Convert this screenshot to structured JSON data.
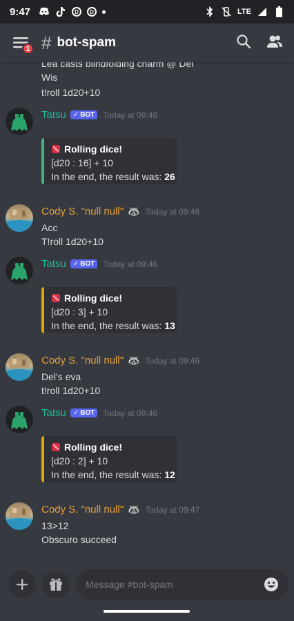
{
  "status_bar": {
    "time": "9:47",
    "lte": "LTE"
  },
  "header": {
    "hash": "#",
    "channel": "bot-spam",
    "badge_count": "1"
  },
  "messages": {
    "m0": {
      "line1": "Lea casts blindfolding charm @ Del",
      "line2": "Wis",
      "line3": "t!roll 1d20+10"
    },
    "m1": {
      "user": "Tatsu",
      "bot": "BOT",
      "time": "Today at 09:46",
      "embed": {
        "title": "Rolling dice!",
        "roll": "[d20 : 16] + 10",
        "result_prefix": "In the end, the result was: ",
        "result": "26",
        "accent": "#43b581"
      }
    },
    "m2": {
      "user": "Cody S. \"null null\"",
      "time": "Today at 09:46",
      "line1": "Acc",
      "line2": "T!roll 1d20+10"
    },
    "m3": {
      "user": "Tatsu",
      "bot": "BOT",
      "time": "Today at 09:46",
      "embed": {
        "title": "Rolling dice!",
        "roll": "[d20 : 3] + 10",
        "result_prefix": "In the end, the result was: ",
        "result": "13",
        "accent": "#e6a700"
      }
    },
    "m4": {
      "user": "Cody S. \"null null\"",
      "time": "Today at 09:46",
      "line1": "Del's eva",
      "line2": "t!roll 1d20+10"
    },
    "m5": {
      "user": "Tatsu",
      "bot": "BOT",
      "time": "Today at 09:46",
      "embed": {
        "title": "Rolling dice!",
        "roll": "[d20 : 2] + 10",
        "result_prefix": "In the end, the result was: ",
        "result": "12",
        "accent": "#e6a700"
      }
    },
    "m6": {
      "user": "Cody S. \"null null\"",
      "time": "Today at 09:47",
      "line1": "13>12",
      "line2": "Obscuro succeed"
    }
  },
  "composer": {
    "placeholder": "Message #bot-spam"
  },
  "colors": {
    "background": "#36393f",
    "bot_tag": "#5865f2",
    "tatsu": "#1abc9c",
    "cody": "#e6a23c",
    "badge": "#ed4245"
  }
}
